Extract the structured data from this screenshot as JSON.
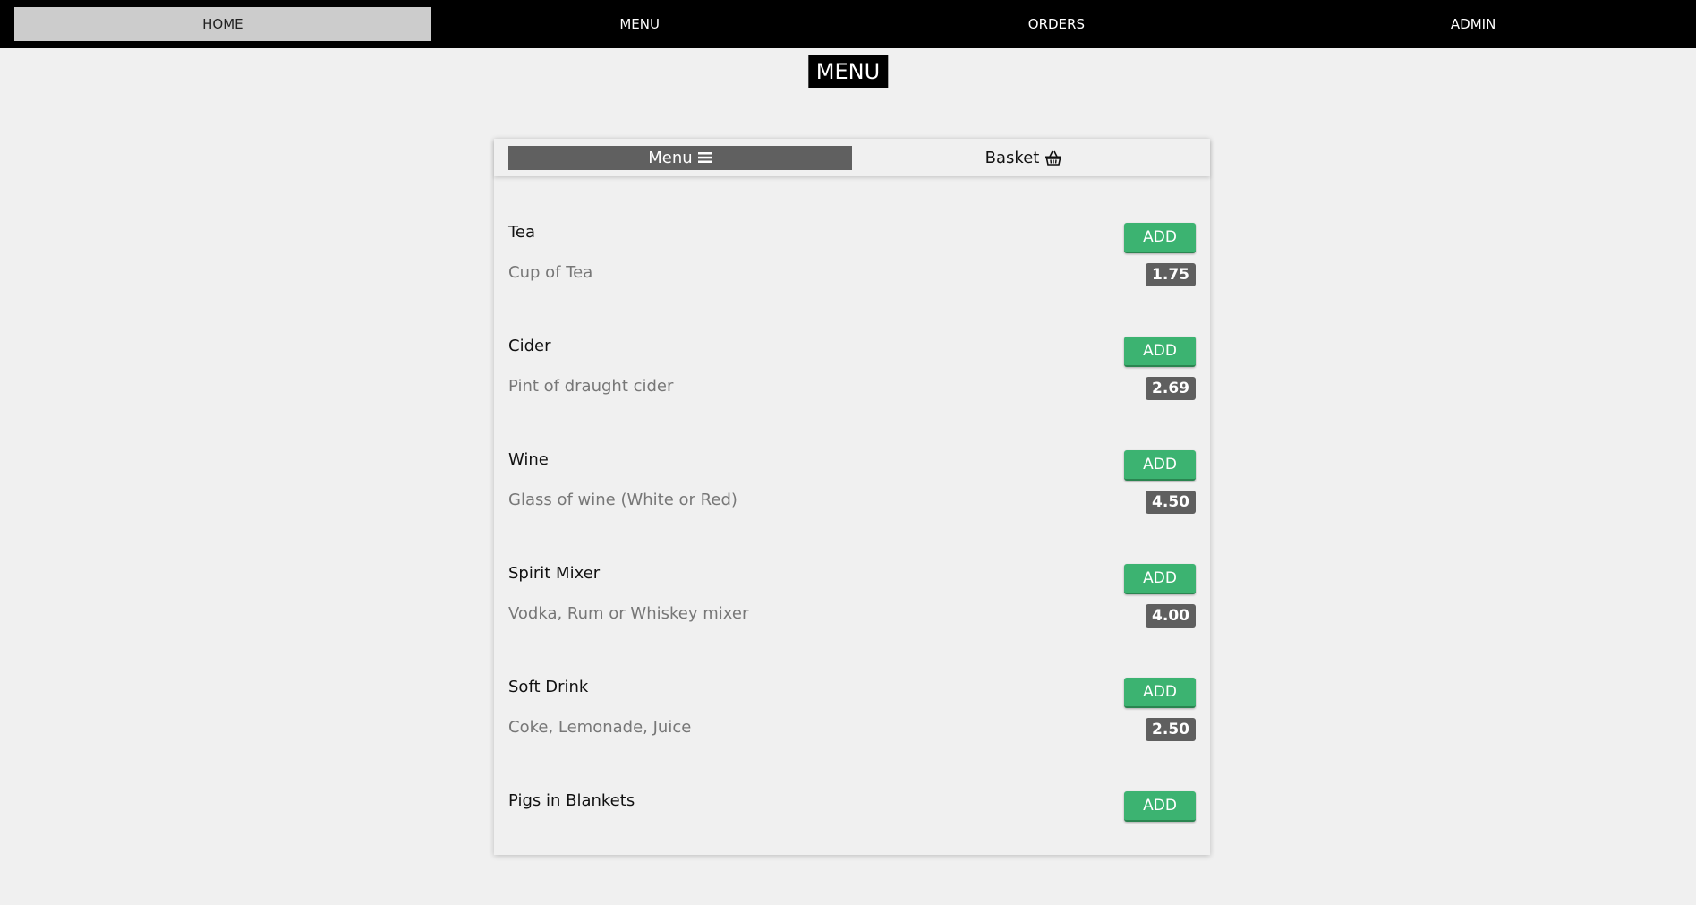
{
  "nav": {
    "items": [
      {
        "label": "HOME"
      },
      {
        "label": "MENU"
      },
      {
        "label": "ORDERS"
      },
      {
        "label": "ADMIN"
      }
    ],
    "active": "HOME"
  },
  "page_title": "MENU",
  "tabs": {
    "menu_label": "Menu",
    "menu_icon": "hamburger-icon",
    "basket_label": "Basket",
    "basket_icon": "basket-icon"
  },
  "menu_items": [
    {
      "name": "Tea",
      "description": "Cup of Tea",
      "price": "1.75",
      "button": "ADD"
    },
    {
      "name": "Cider",
      "description": "Pint of draught cider",
      "price": "2.69",
      "button": "ADD"
    },
    {
      "name": "Wine",
      "description": "Glass of wine (White or Red)",
      "price": "4.50",
      "button": "ADD"
    },
    {
      "name": "Spirit Mixer",
      "description": "Vodka, Rum or Whiskey mixer",
      "price": "4.00",
      "button": "ADD"
    },
    {
      "name": "Soft Drink",
      "description": "Coke, Lemonade, Juice",
      "price": "2.50",
      "button": "ADD"
    },
    {
      "name": "Pigs in Blankets",
      "button": "ADD"
    }
  ],
  "colors": {
    "nav_bg": "#000000",
    "nav_active": "#cccccc",
    "add_button": "#3cb371",
    "price_badge": "#5f5f5f",
    "tab_active": "#606060"
  }
}
